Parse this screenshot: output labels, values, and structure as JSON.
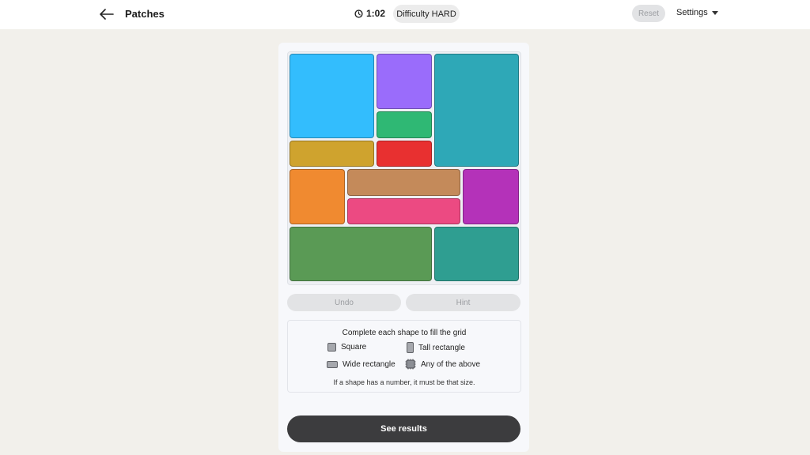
{
  "header": {
    "title": "Patches",
    "timer": "1:02",
    "difficulty": "Difficulty HARD",
    "reset_label": "Reset",
    "settings_label": "Settings"
  },
  "board": {
    "pieces": [
      {
        "name": "piece-blue",
        "color": "#33bdfd"
      },
      {
        "name": "piece-purple",
        "color": "#9a6cfb"
      },
      {
        "name": "piece-green",
        "color": "#2fb874"
      },
      {
        "name": "piece-teal-tall",
        "color": "#2ea8b7"
      },
      {
        "name": "piece-mustard",
        "color": "#cfa32e"
      },
      {
        "name": "piece-red",
        "color": "#e83030"
      },
      {
        "name": "piece-orange",
        "color": "#f08a30"
      },
      {
        "name": "piece-tan",
        "color": "#c48a5a"
      },
      {
        "name": "piece-magenta",
        "color": "#b432b9"
      },
      {
        "name": "piece-pink",
        "color": "#ec4a82"
      },
      {
        "name": "piece-forest",
        "color": "#5a9a55"
      },
      {
        "name": "piece-sea-teal",
        "color": "#2f9e91"
      }
    ]
  },
  "controls": {
    "undo_label": "Undo",
    "hint_label": "Hint"
  },
  "legend": {
    "title": "Complete each shape to fill the grid",
    "square": "Square",
    "tall": "Tall rectangle",
    "wide": "Wide rectangle",
    "any": "Any of the above",
    "note": "If a shape has a number, it must be that size."
  },
  "results_label": "See results"
}
